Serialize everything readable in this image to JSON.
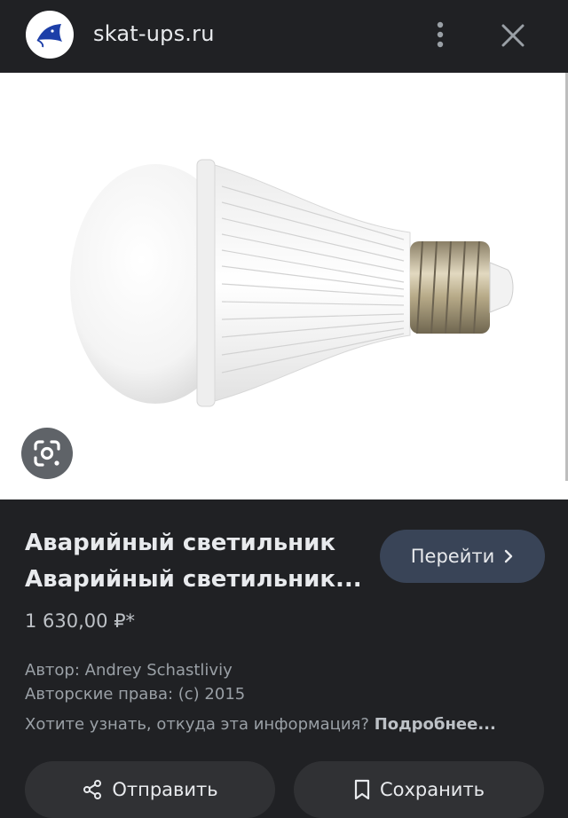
{
  "header": {
    "site_name": "skat-ups.ru",
    "logo_icon": "stingray-logo-icon",
    "more_icon": "more-vert-icon",
    "close_icon": "close-icon"
  },
  "image": {
    "subject": "led-bulb-image",
    "lens_icon": "lens-search-icon"
  },
  "result": {
    "title_line1": "Аварийный светильник",
    "title_line2": "Аварийный светильник...",
    "visit_label": "Перейти",
    "price": "1 630,00 ₽*",
    "author": "Автор: Andrey Schastliviy",
    "copyright": "Авторские права: (c) 2015",
    "info_question": "Хотите узнать, откуда эта информация?",
    "info_link": "Подробнее..."
  },
  "actions": {
    "share_label": "Отправить",
    "save_label": "Сохранить"
  },
  "colors": {
    "background": "#202124",
    "visit_button": "#394457",
    "action_button": "#303134",
    "logo_blue": "#1d3fa8"
  }
}
